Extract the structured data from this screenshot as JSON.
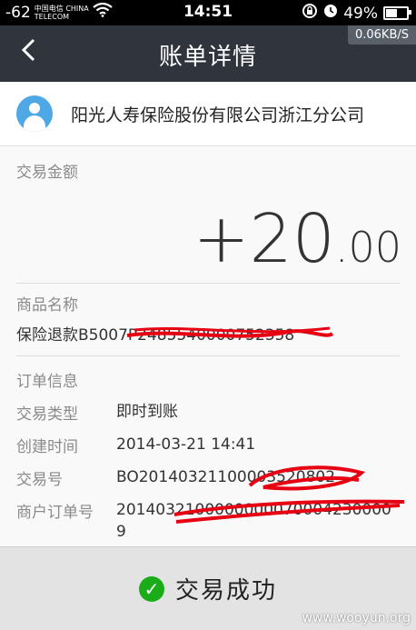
{
  "status_bar": {
    "signal": "-62",
    "carrier": "中国电信 CHINA TELECOM",
    "time": "14:51",
    "battery": "49%",
    "battery_level": 0.49
  },
  "nav": {
    "back_icon": "chevron-left-icon",
    "title": "账单详情",
    "network_speed": "0.06KB/S"
  },
  "merchant": {
    "avatar_icon": "user-icon",
    "name": "阳光人寿保险股份有限公司浙江分公司"
  },
  "amount": {
    "label": "交易金额",
    "integer": "+20",
    "cents": ".00"
  },
  "product": {
    "label": "商品名称",
    "value": "保险退款B5007P2485540000752358"
  },
  "order": {
    "label": "订单信息",
    "rows": [
      {
        "key": "交易类型",
        "value": "即时到账"
      },
      {
        "key": "创建时间",
        "value": "2014-03-21 14:41"
      },
      {
        "key": "交易号",
        "value": "BO20140321100003520802"
      },
      {
        "key": "商户订单号",
        "value": "20140321000000000700042300009"
      }
    ]
  },
  "result": {
    "icon": "check-circle-icon",
    "text": "交易成功"
  },
  "watermark": "www.wooyun.org",
  "colors": {
    "nav_bg": "#30343c",
    "avatar": "#4fa8e6",
    "success": "#1aad19",
    "redaction": "#e60012"
  }
}
